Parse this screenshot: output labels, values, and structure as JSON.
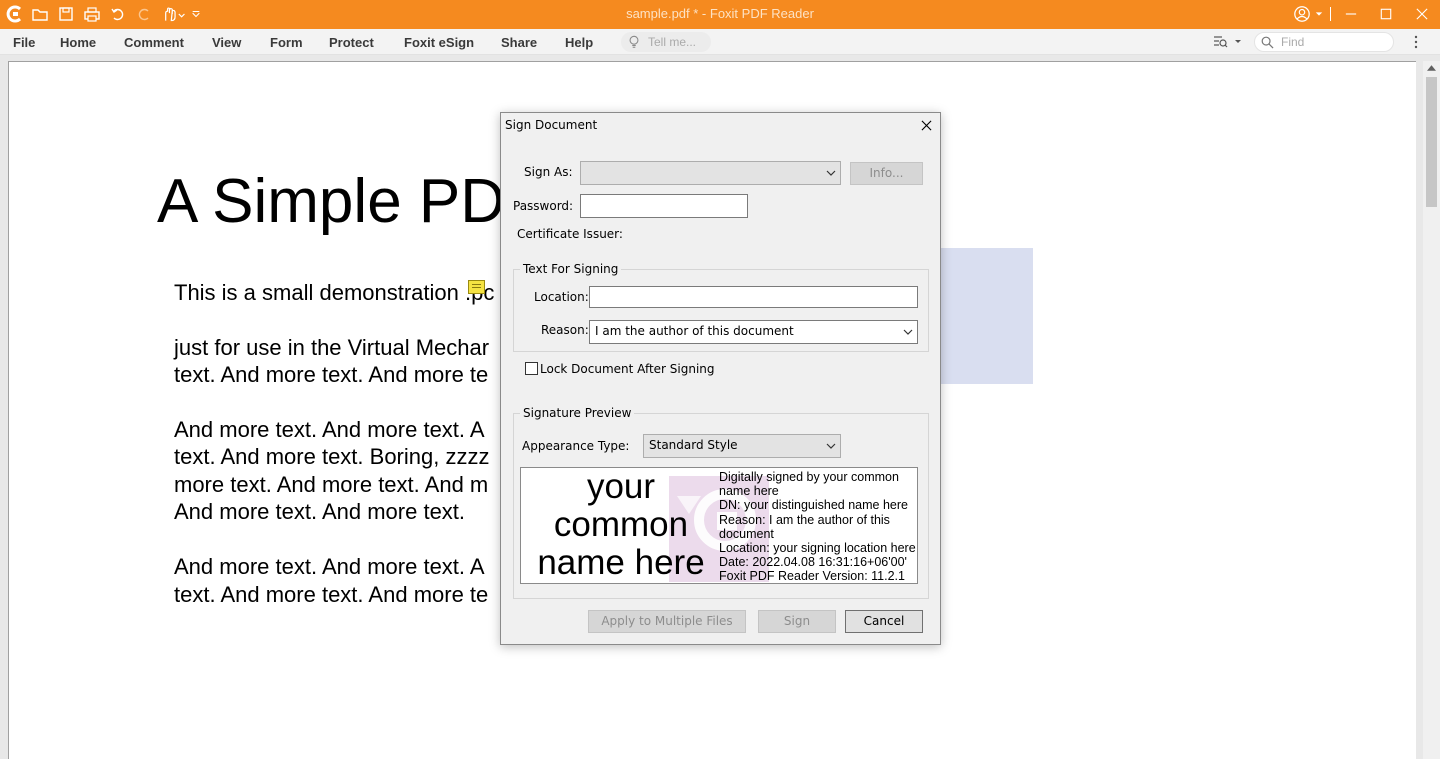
{
  "app": {
    "window_title": "sample.pdf * - Foxit PDF Reader"
  },
  "menu": {
    "items": [
      "File",
      "Home",
      "Comment",
      "View",
      "Form",
      "Protect",
      "Foxit eSign",
      "Share",
      "Help"
    ],
    "tell_me_placeholder": "Tell me...",
    "find_placeholder": "Find"
  },
  "document": {
    "title": "A Simple PD",
    "lines": [
      "This is a small demonstration .pc",
      "just for use in the Virtual Mechar",
      "text. And more text. And more te",
      "And more text. And more text. A",
      "text. And more text. Boring, zzzz",
      "more text. And more text. And m",
      "And more text. And more text.",
      "And more text. And more text. A",
      "text. And more text. And more te"
    ]
  },
  "dialog": {
    "title": "Sign Document",
    "sign_as_label": "Sign As:",
    "sign_as_value": "",
    "info_button": "Info...",
    "password_label": "Password:",
    "password_value": "",
    "cert_issuer_label": "Certificate Issuer:",
    "text_for_signing": {
      "group_title": "Text For Signing",
      "location_label": "Location:",
      "location_value": "",
      "reason_label": "Reason:",
      "reason_value": "I am the author of this document"
    },
    "lock_document_label": "Lock Document After Signing",
    "lock_document_checked": false,
    "signature_preview": {
      "group_title": "Signature Preview",
      "appearance_type_label": "Appearance Type:",
      "appearance_type_value": "Standard Style",
      "name_lines": [
        "your",
        "common",
        "name here"
      ],
      "detail_lines": [
        "Digitally signed by your common",
        "name here",
        "DN: your distinguished name here",
        "Reason: I am the author of this",
        "document",
        "Location: your signing location here",
        "Date: 2022.04.08 16:31:16+06'00'",
        "Foxit PDF Reader Version: 11.2.1"
      ]
    },
    "buttons": {
      "apply_multiple": "Apply to Multiple Files",
      "sign": "Sign",
      "cancel": "Cancel"
    }
  },
  "colors": {
    "titlebar": "#f58a1f",
    "highlight": "#d9def0"
  }
}
